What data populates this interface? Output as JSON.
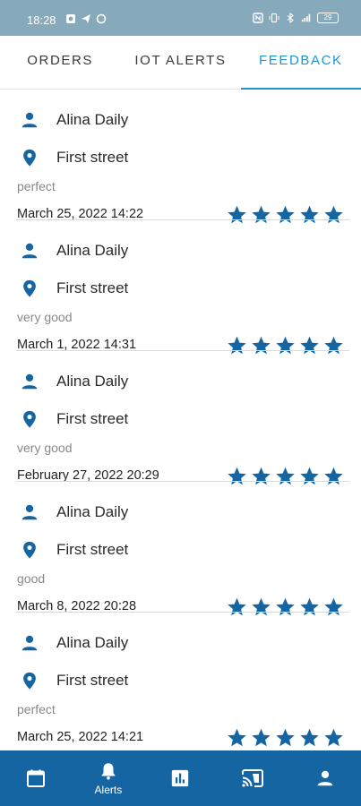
{
  "status_bar": {
    "time": "18:28",
    "battery": "29"
  },
  "tabs": [
    {
      "label": "ORDERS",
      "active": false
    },
    {
      "label": "IOT ALERTS",
      "active": false
    },
    {
      "label": "FEEDBACK",
      "active": true
    }
  ],
  "colors": {
    "accent": "#1a96d4",
    "icon_blue": "#1565a3",
    "status_bar": "#87a9bc"
  },
  "feedback": [
    {
      "name": "Alina Daily",
      "address": "First street",
      "comment": "perfect",
      "date": "March 25, 2022 14:22",
      "rating": 5
    },
    {
      "name": "Alina Daily",
      "address": "First street",
      "comment": "very good",
      "date": "March 1, 2022 14:31",
      "rating": 5
    },
    {
      "name": "Alina Daily",
      "address": "First street",
      "comment": "very good",
      "date": "February 27, 2022 20:29",
      "rating": 5
    },
    {
      "name": "Alina Daily",
      "address": "First street",
      "comment": "good",
      "date": "March 8, 2022 20:28",
      "rating": 5
    },
    {
      "name": "Alina Daily",
      "address": "First street",
      "comment": "perfect",
      "date": "March 25, 2022 14:21",
      "rating": 5
    }
  ],
  "bottom_nav": [
    {
      "icon": "calendar-icon",
      "label": ""
    },
    {
      "icon": "bell-icon",
      "label": "Alerts"
    },
    {
      "icon": "bar-chart-icon",
      "label": ""
    },
    {
      "icon": "cast-icon",
      "label": ""
    },
    {
      "icon": "person-icon",
      "label": ""
    }
  ]
}
